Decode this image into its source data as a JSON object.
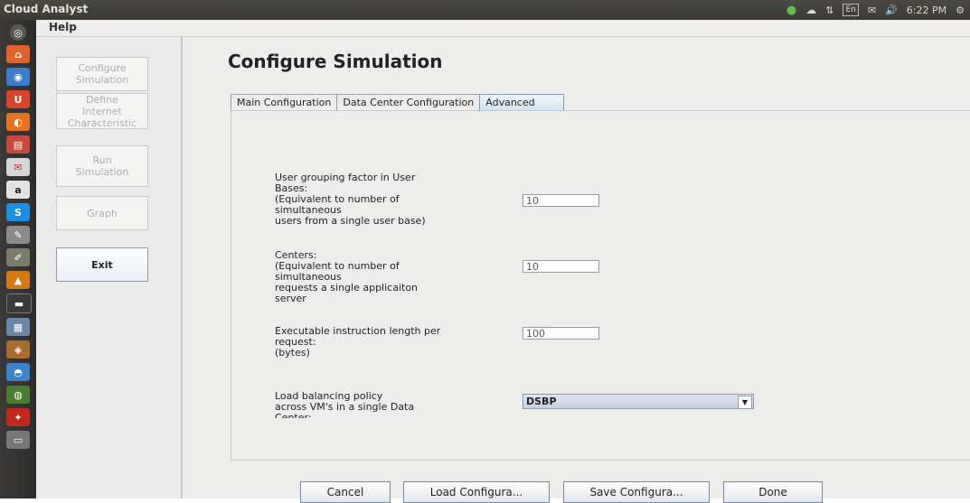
{
  "window": {
    "title": "Cloud Analyst"
  },
  "tray": {
    "keyboard": "En",
    "time": "6:22 PM"
  },
  "menu": {
    "help": "Help"
  },
  "nav": {
    "configure": "Configure\nSimulation",
    "define": "Define\nInternet\nCharacteristic",
    "run": "Run\nSimulation",
    "graph": "Graph",
    "exit": "Exit"
  },
  "page": {
    "title": "Configure Simulation"
  },
  "tabs": [
    "Main Configuration",
    "Data Center Configuration",
    "Advanced"
  ],
  "advanced": {
    "user_grouping": {
      "label": "User grouping factor in User\nBases:\n(Equivalent to number of\nsimultaneous\nusers from a single user base)",
      "value": "10"
    },
    "request_grouping": {
      "label": "Centers:\n(Equivalent to number of\nsimultaneous\nrequests a single applicaiton\nserver",
      "value": "10"
    },
    "exec_length": {
      "label": "Executable instruction length per\nrequest:\n(bytes)",
      "value": "100"
    },
    "load_balancing": {
      "label": "Load balancing policy\nacross VM's in a single Data\nCenter:",
      "value": "DSBP"
    }
  },
  "buttons": {
    "cancel": "Cancel",
    "load": "Load Configura...",
    "save": "Save Configura...",
    "done": "Done"
  }
}
